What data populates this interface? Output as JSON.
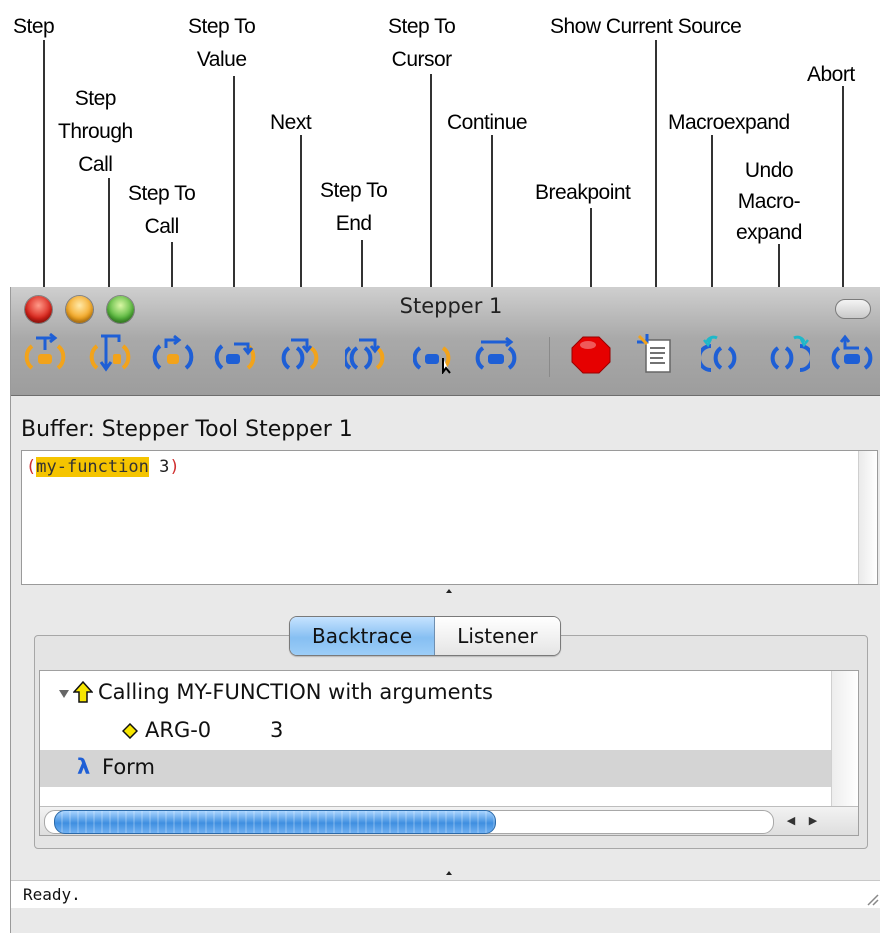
{
  "callouts": {
    "step": "Step",
    "step_through_call": "Step\nThrough\nCall",
    "step_to_call": "Step To\nCall",
    "step_to_value": "Step To\nValue",
    "next": "Next",
    "step_to_end": "Step To\nEnd",
    "step_to_cursor": "Step To\nCursor",
    "continue": "Continue",
    "breakpoint": "Breakpoint",
    "show_current_source": "Show Current Source",
    "macroexpand": "Macroexpand",
    "undo_macroexpand": "Undo\nMacro-\nexpand",
    "abort": "Abort"
  },
  "window": {
    "title": "Stepper 1"
  },
  "toolbar": {
    "icons": [
      "step-icon",
      "step-through-call-icon",
      "step-to-call-icon",
      "step-to-value-icon",
      "next-icon",
      "step-to-end-icon",
      "step-to-cursor-icon",
      "continue-icon",
      "breakpoint-icon",
      "show-current-source-icon",
      "macroexpand-icon",
      "undo-macroexpand-icon",
      "abort-icon"
    ],
    "colors": {
      "orange": "#f2a31b",
      "blue": "#1e5fd6",
      "cyan": "#1fb8c9",
      "red": "#e60000"
    }
  },
  "buffer": {
    "label": "Buffer: Stepper Tool Stepper 1",
    "code_open": "(",
    "code_function": "my-function",
    "code_rest": " 3",
    "code_close": ")",
    "highlight_color": "#f5c400"
  },
  "tabs": {
    "backtrace": "Backtrace",
    "listener": "Listener",
    "active": "Backtrace"
  },
  "backtrace": {
    "frame_text": "Calling MY-FUNCTION with arguments",
    "arg_name": "ARG-0",
    "arg_value": "3",
    "form_glyph": "λ",
    "form_label": "Form"
  },
  "status": {
    "text": "Ready."
  }
}
